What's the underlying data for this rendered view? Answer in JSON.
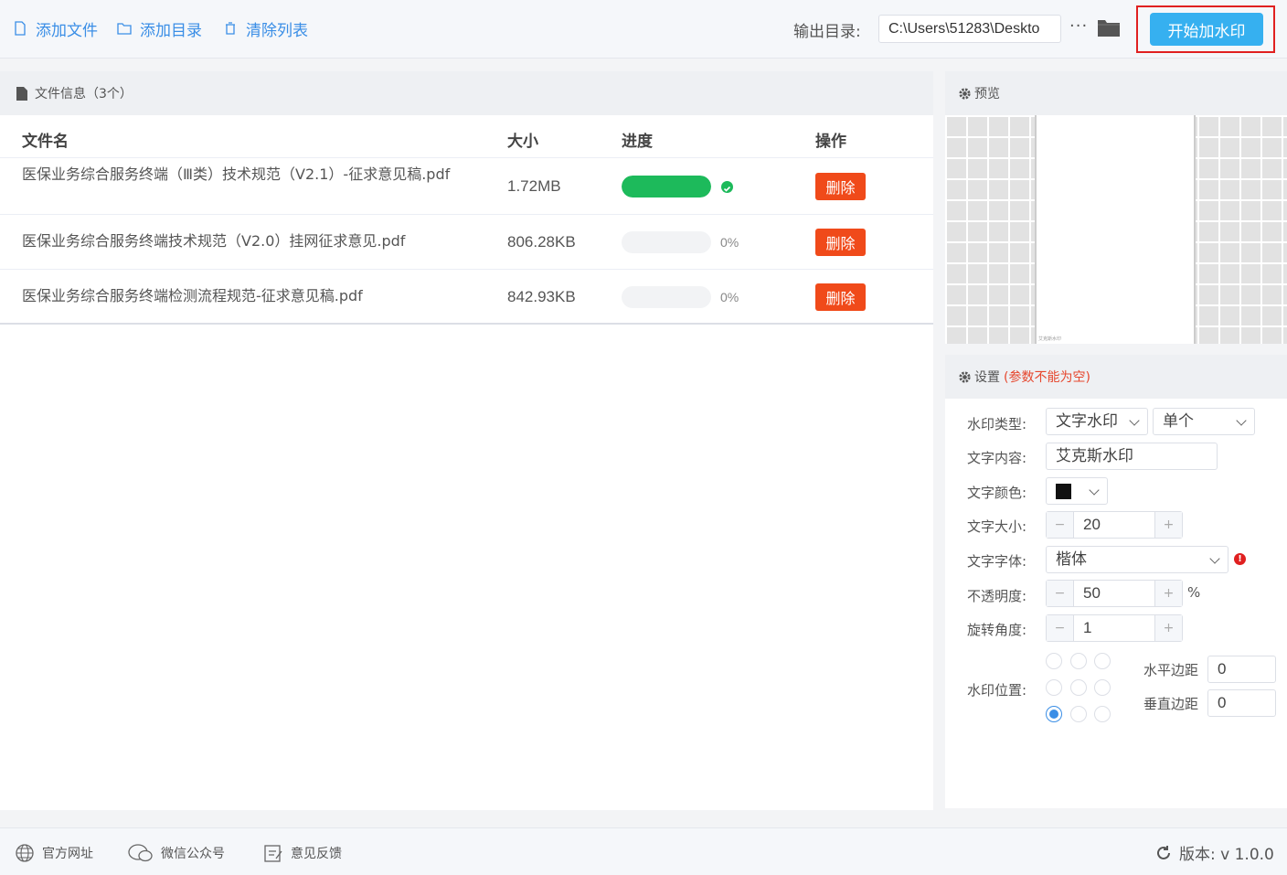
{
  "toolbar": {
    "add_file": "添加文件",
    "add_dir": "添加目录",
    "clear_list": "清除列表",
    "output_label": "输出目录:",
    "output_path": "C:\\Users\\51283\\Deskto",
    "more": "···",
    "start": "开始加水印"
  },
  "file_panel": {
    "title": "文件信息（3个）",
    "columns": {
      "name": "文件名",
      "size": "大小",
      "progress": "进度",
      "action": "操作"
    },
    "files": [
      {
        "name": "医保业务综合服务终端（Ⅲ类）技术规范（V2.1）-征求意见稿.pdf",
        "size": "1.72MB",
        "progress": 1.0,
        "progress_text": "",
        "delete": "删除"
      },
      {
        "name": "医保业务综合服务终端技术规范（V2.0）挂网征求意见.pdf",
        "size": "806.28KB",
        "progress": 0,
        "progress_text": "0%",
        "delete": "删除"
      },
      {
        "name": "医保业务综合服务终端检测流程规范-征求意见稿.pdf",
        "size": "842.93KB",
        "progress": 0,
        "progress_text": "0%",
        "delete": "删除"
      }
    ]
  },
  "preview": {
    "title": "预览",
    "watermark_sample": "艾克斯水印"
  },
  "settings": {
    "title": "设置",
    "note": "(参数不能为空)",
    "type_label": "水印类型:",
    "type_value": "文字水印",
    "mode_value": "单个",
    "content_label": "文字内容:",
    "content_value": "艾克斯水印",
    "color_label": "文字颜色:",
    "color_value": "#111111",
    "size_label": "文字大小:",
    "size_value": "20",
    "font_label": "文字字体:",
    "font_value": "楷体",
    "opacity_label": "不透明度:",
    "opacity_value": "50",
    "opacity_unit": "%",
    "rotate_label": "旋转角度:",
    "rotate_value": "1",
    "position_label": "水印位置:",
    "h_margin_label": "水平边距",
    "h_margin_value": "0",
    "v_margin_label": "垂直边距",
    "v_margin_value": "0",
    "minus": "−",
    "plus": "+"
  },
  "footer": {
    "website": "官方网址",
    "wechat": "微信公众号",
    "feedback": "意见反馈",
    "version": "版本: v 1.0.0"
  }
}
